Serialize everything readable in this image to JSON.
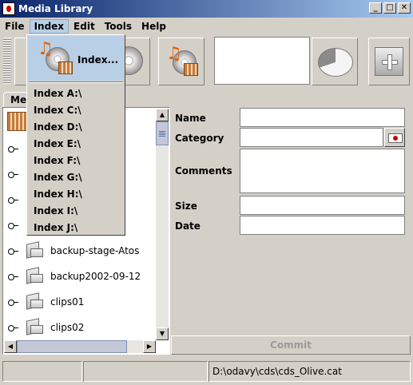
{
  "window": {
    "title": "Media Library",
    "minimize": "_",
    "maximize": "□",
    "close": "✕"
  },
  "menubar": [
    "File",
    "Index",
    "Edit",
    "Tools",
    "Help"
  ],
  "index_menu": {
    "header_label": "Index...",
    "items": [
      "Index A:\\",
      "Index C:\\",
      "Index D:\\",
      "Index E:\\",
      "Index F:\\",
      "Index G:\\",
      "Index H:\\",
      "Index I:\\",
      "Index J:\\"
    ]
  },
  "tab": {
    "label": "Med"
  },
  "tree": {
    "items": [
      {
        "label": ""
      },
      {
        "label": ""
      },
      {
        "label": ""
      },
      {
        "label": ""
      },
      {
        "label": ""
      },
      {
        "label": "backup-stage-Atos"
      },
      {
        "label": "backup2002-09-12"
      },
      {
        "label": "clips01"
      },
      {
        "label": "clips02"
      }
    ]
  },
  "form": {
    "name_label": "Name",
    "category_label": "Category",
    "comments_label": "Comments",
    "size_label": "Size",
    "date_label": "Date",
    "commit_label": "Commit"
  },
  "status": {
    "cell1": "",
    "cell2": "",
    "path": "D:\\odavy\\cds\\cds_Olive.cat"
  },
  "colors": {
    "menu_highlight": "#b8cfe5",
    "titlebar": "#0a246a",
    "window_bg": "#d4d0c8"
  }
}
